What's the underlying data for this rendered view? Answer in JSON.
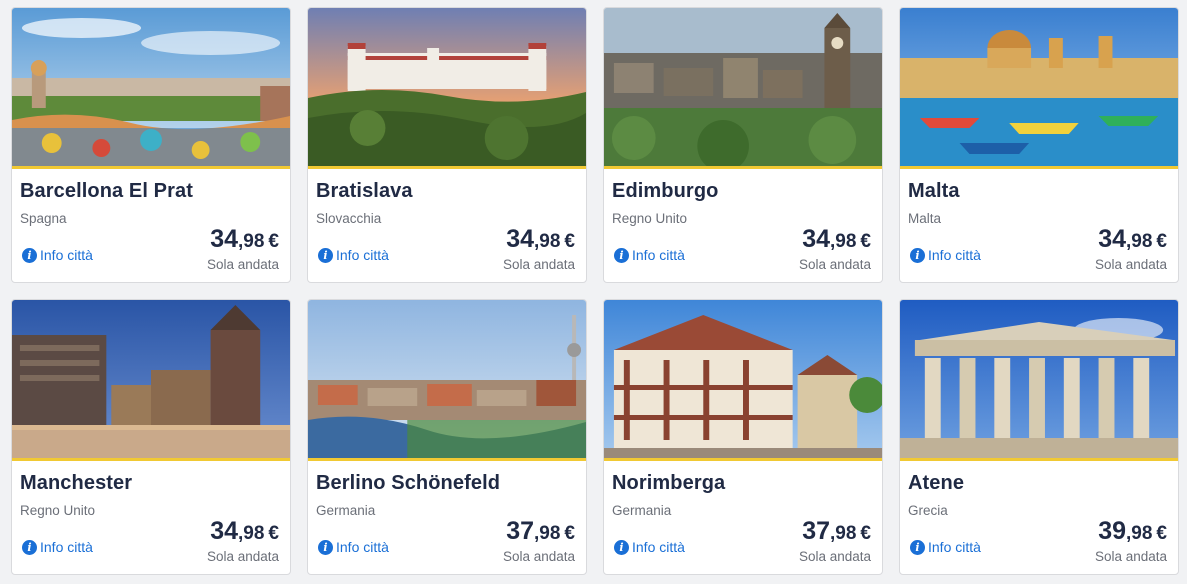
{
  "cards": [
    {
      "city": "Barcellona El Prat",
      "country": "Spagna",
      "info": "Info città",
      "price_int": "34",
      "price_dec": ",98",
      "currency": "€",
      "trip": "Sola andata"
    },
    {
      "city": "Bratislava",
      "country": "Slovacchia",
      "info": "Info città",
      "price_int": "34",
      "price_dec": ",98",
      "currency": "€",
      "trip": "Sola andata"
    },
    {
      "city": "Edimburgo",
      "country": "Regno Unito",
      "info": "Info città",
      "price_int": "34",
      "price_dec": ",98",
      "currency": "€",
      "trip": "Sola andata"
    },
    {
      "city": "Malta",
      "country": "Malta",
      "info": "Info città",
      "price_int": "34",
      "price_dec": ",98",
      "currency": "€",
      "trip": "Sola andata"
    },
    {
      "city": "Manchester",
      "country": "Regno Unito",
      "info": "Info città",
      "price_int": "34",
      "price_dec": ",98",
      "currency": "€",
      "trip": "Sola andata"
    },
    {
      "city": "Berlino Schönefeld",
      "country": "Germania",
      "info": "Info città",
      "price_int": "37",
      "price_dec": ",98",
      "currency": "€",
      "trip": "Sola andata"
    },
    {
      "city": "Norimberga",
      "country": "Germania",
      "info": "Info città",
      "price_int": "37",
      "price_dec": ",98",
      "currency": "€",
      "trip": "Sola andata"
    },
    {
      "city": "Atene",
      "country": "Grecia",
      "info": "Info città",
      "price_int": "39",
      "price_dec": ",98",
      "currency": "€",
      "trip": "Sola andata"
    }
  ],
  "colors": {
    "accent": "#f1c933",
    "link": "#1a6fd6",
    "title": "#202a44"
  },
  "icons": {
    "info": "info-icon",
    "info_glyph": "i"
  }
}
